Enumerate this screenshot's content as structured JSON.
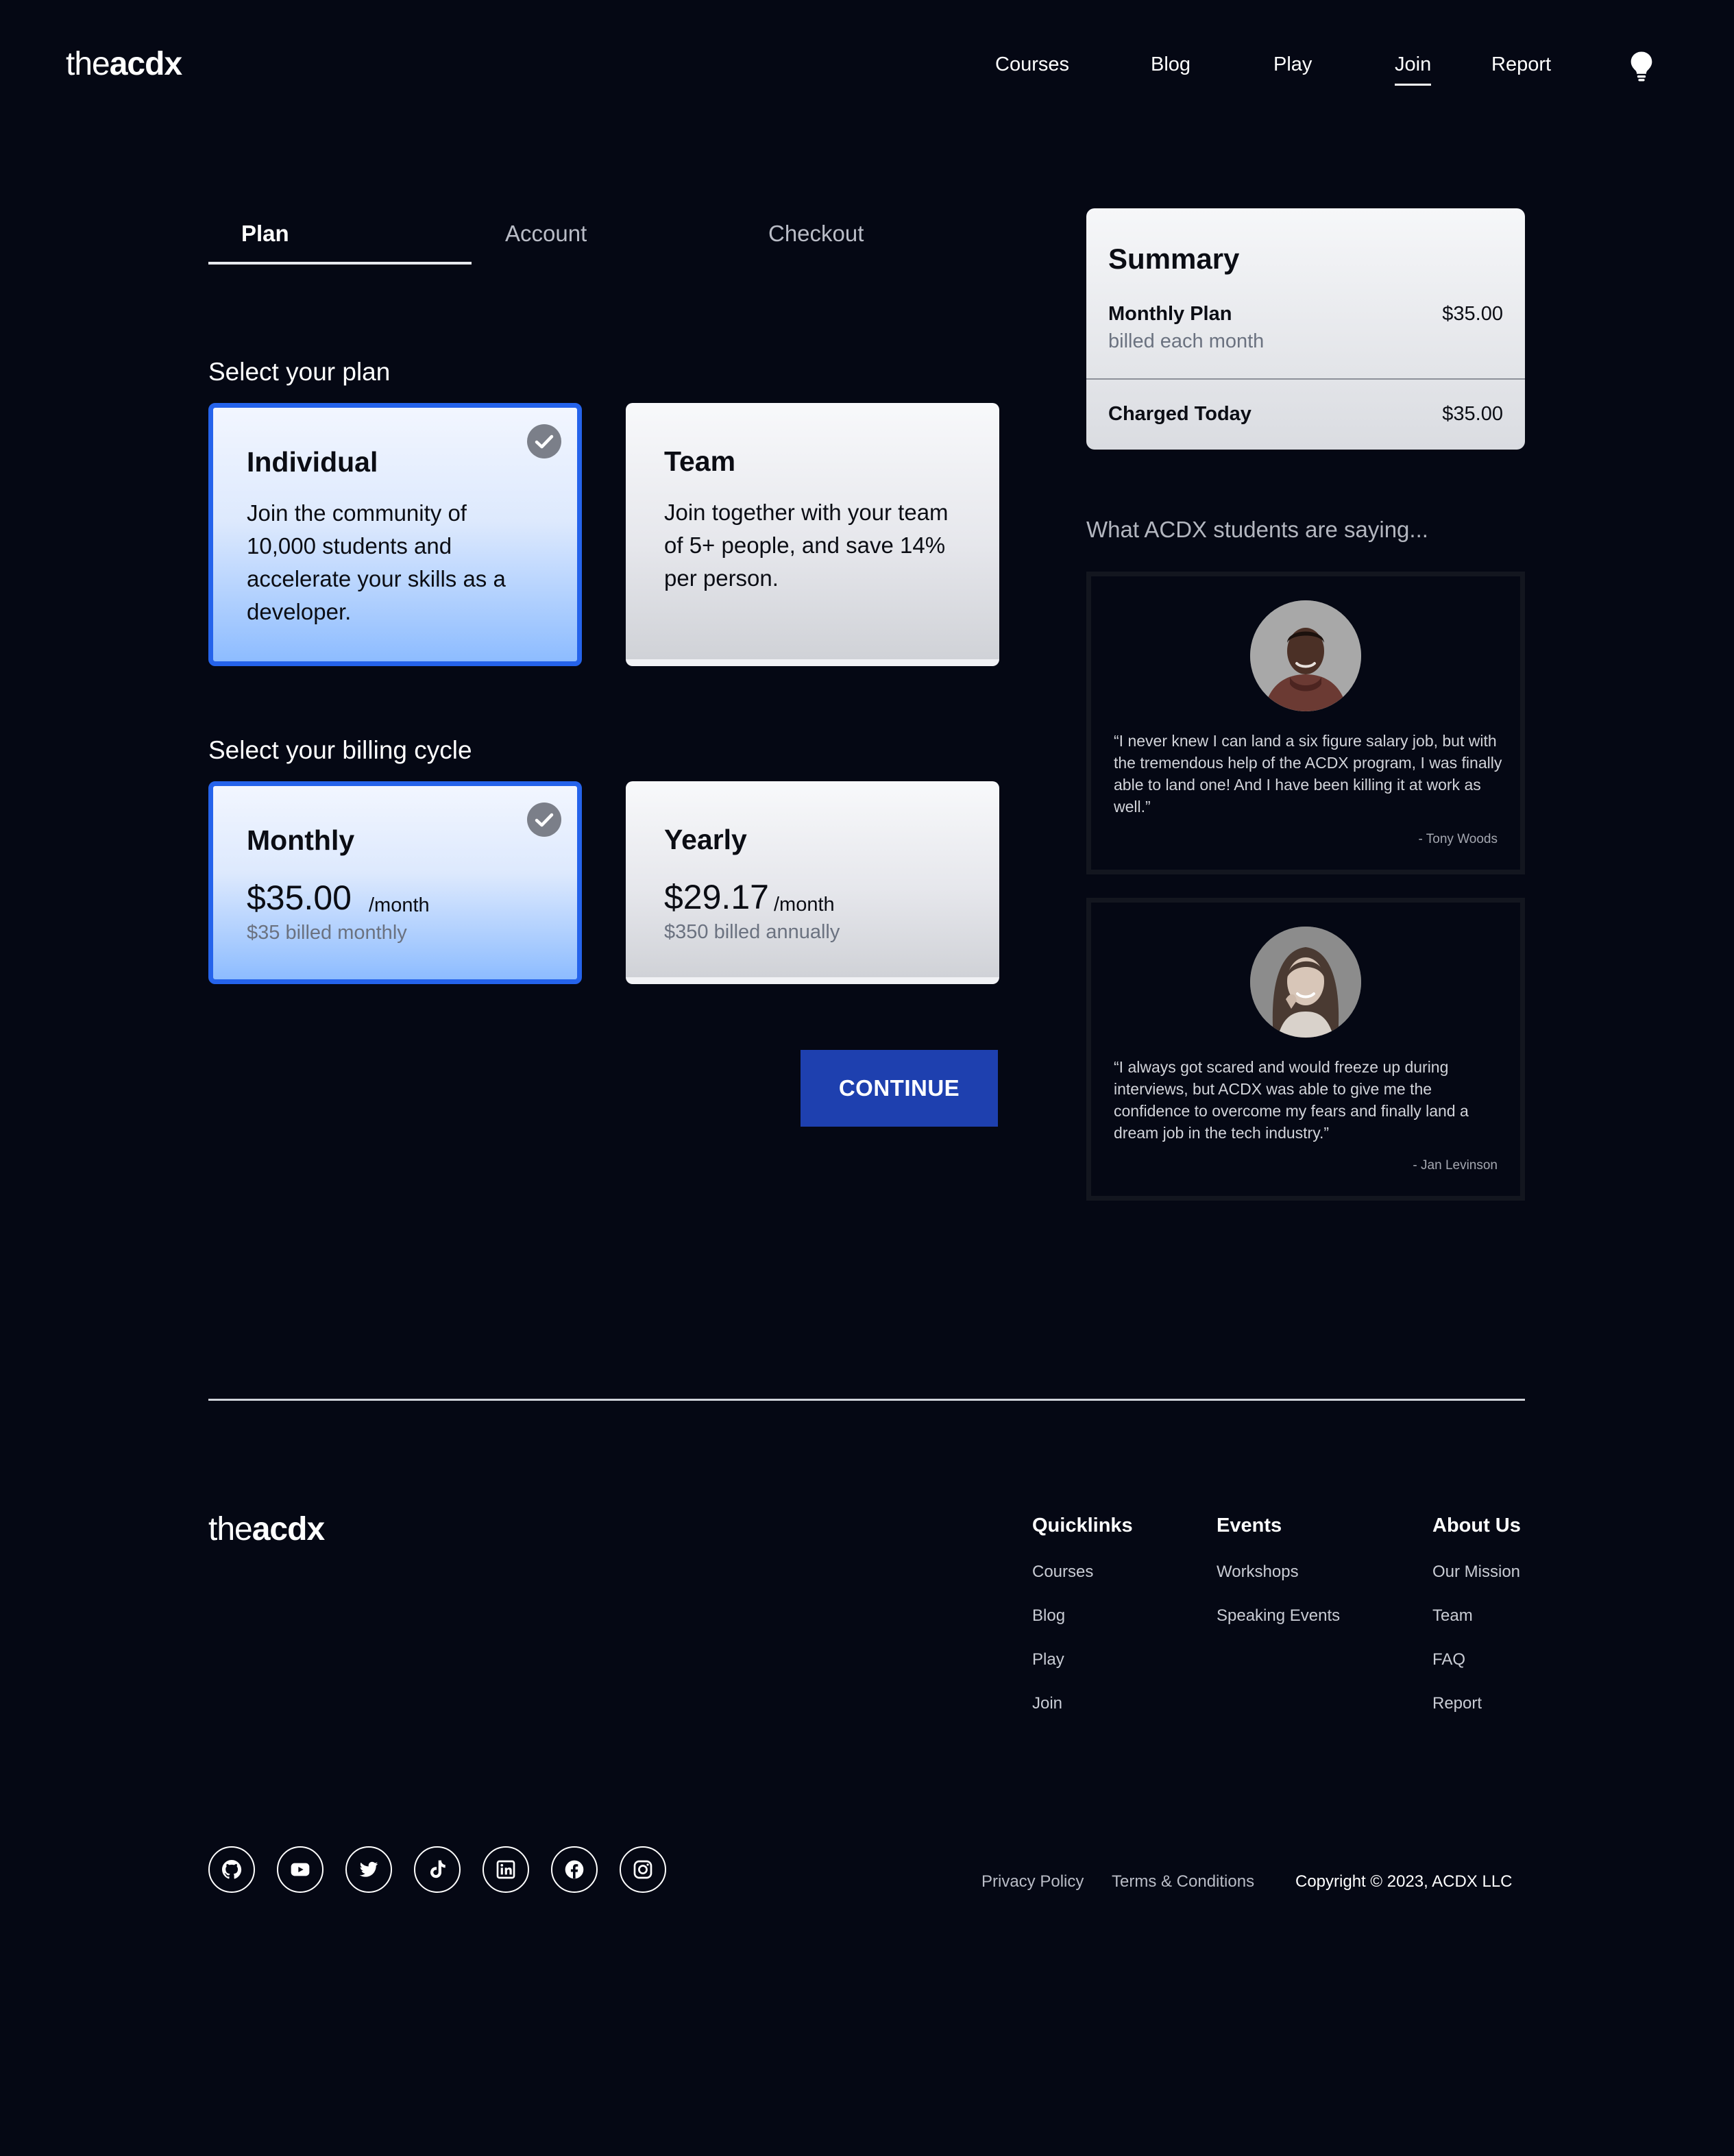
{
  "header": {
    "logo_thin": "the",
    "logo_bold": "acdx",
    "nav": [
      "Courses",
      "Blog",
      "Play",
      "Join",
      "Report"
    ],
    "active_nav": "Join",
    "theme_icon": "lightbulb-icon"
  },
  "steps": [
    "Plan",
    "Account",
    "Checkout"
  ],
  "plan_section": {
    "label": "Select your plan",
    "options": [
      {
        "title": "Individual",
        "desc": "Join the community of 10,000 students and accelerate your skills as a developer.",
        "selected": true
      },
      {
        "title": "Team",
        "desc": "Join together with your team of 5+ people, and save 14% per person.",
        "selected": false
      }
    ]
  },
  "billing_section": {
    "label": "Select your billing cycle",
    "options": [
      {
        "title": "Monthly",
        "price": "$35.00",
        "per": "/month",
        "billed": "$35 billed monthly",
        "selected": true
      },
      {
        "title": "Yearly",
        "price": "$29.17",
        "per": "/month",
        "billed": "$350 billed annually",
        "selected": false
      }
    ]
  },
  "continue_label": "CONTINUE",
  "summary": {
    "title": "Summary",
    "plan_label": "Monthly Plan",
    "plan_sub": "billed each month",
    "plan_value": "$35.00",
    "total_label": "Charged Today",
    "total_value": "$35.00"
  },
  "testimonials": {
    "heading": "What ACDX students are saying...",
    "items": [
      {
        "quote": "“I never knew I can land a six figure salary job, but with the tremendous help of the ACDX program, I was finally able to land one! And I have been killing it at work as well.”",
        "author": "- Tony Woods"
      },
      {
        "quote": "“I always got scared and would freeze up during interviews, but ACDX was able to give me the confidence to overcome my fears and finally land a dream job in the tech industry.”",
        "author": "- Jan Levinson"
      }
    ]
  },
  "footer": {
    "logo_thin": "the",
    "logo_bold": "acdx",
    "columns": [
      {
        "title": "Quicklinks",
        "links": [
          "Courses",
          "Blog",
          "Play",
          "Join"
        ]
      },
      {
        "title": "Events",
        "links": [
          "Workshops",
          "Speaking Events"
        ]
      },
      {
        "title": "About Us",
        "links": [
          "Our Mission",
          "Team",
          "FAQ",
          "Report"
        ]
      }
    ],
    "social_icons": [
      "github-icon",
      "youtube-icon",
      "twitter-icon",
      "tiktok-icon",
      "linkedin-icon",
      "facebook-icon",
      "instagram-icon"
    ],
    "privacy": "Privacy Policy",
    "terms": "Terms & Conditions",
    "copyright": "Copyright © 2023, ACDX LLC"
  },
  "colors": {
    "background": "#050814",
    "selected_border": "#2563eb",
    "button": "#1e40af"
  }
}
